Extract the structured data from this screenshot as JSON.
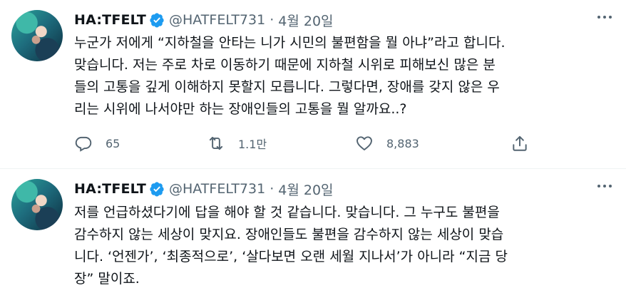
{
  "tweets": [
    {
      "display_name": "HA:TFELT",
      "handle": "@HATFELT731",
      "separator": "·",
      "date": "4월 20일",
      "lines": [
        "누군가 저에게 “지하철을 안타는 니가 시민의 불편함을 뭘 아냐”라고 합니다.",
        "맞습니다. 저는 주로 차로 이동하기 때문에 지하철 시위로 피해보신 많은 분",
        "들의 고통을 깊게 이해하지 못할지 모릅니다. 그렇다면, 장애를 갖지 않은 우",
        "리는 시위에 나서야만 하는 장애인들의 고통을 뭘 알까요..?"
      ],
      "reply_count": "65",
      "retweet_count": "1.1만",
      "like_count": "8,883"
    },
    {
      "display_name": "HA:TFELT",
      "handle": "@HATFELT731",
      "separator": "·",
      "date": "4월 20일",
      "lines": [
        "저를 언급하셨다기에 답을 해야 할 것 같습니다. 맞습니다. 그 누구도 불편을",
        "감수하지 않는 세상이 맞지요. 장애인들도 불편을 감수하지 않는 세상이 맞습",
        "니다. ‘언젠가’, ‘최종적으로’, ‘살다보면 오랜 세월 지나서’가 아니라 “지금 당",
        "장” 말이죠."
      ]
    }
  ],
  "colors": {
    "text": "#0f1419",
    "secondary": "#536471",
    "verified": "#1d9bf0",
    "divider": "#eff3f4"
  },
  "icons": {
    "verified": "verified-badge-icon",
    "more": "more-icon",
    "reply": "reply-icon",
    "retweet": "retweet-icon",
    "like": "heart-icon",
    "share": "share-icon"
  }
}
